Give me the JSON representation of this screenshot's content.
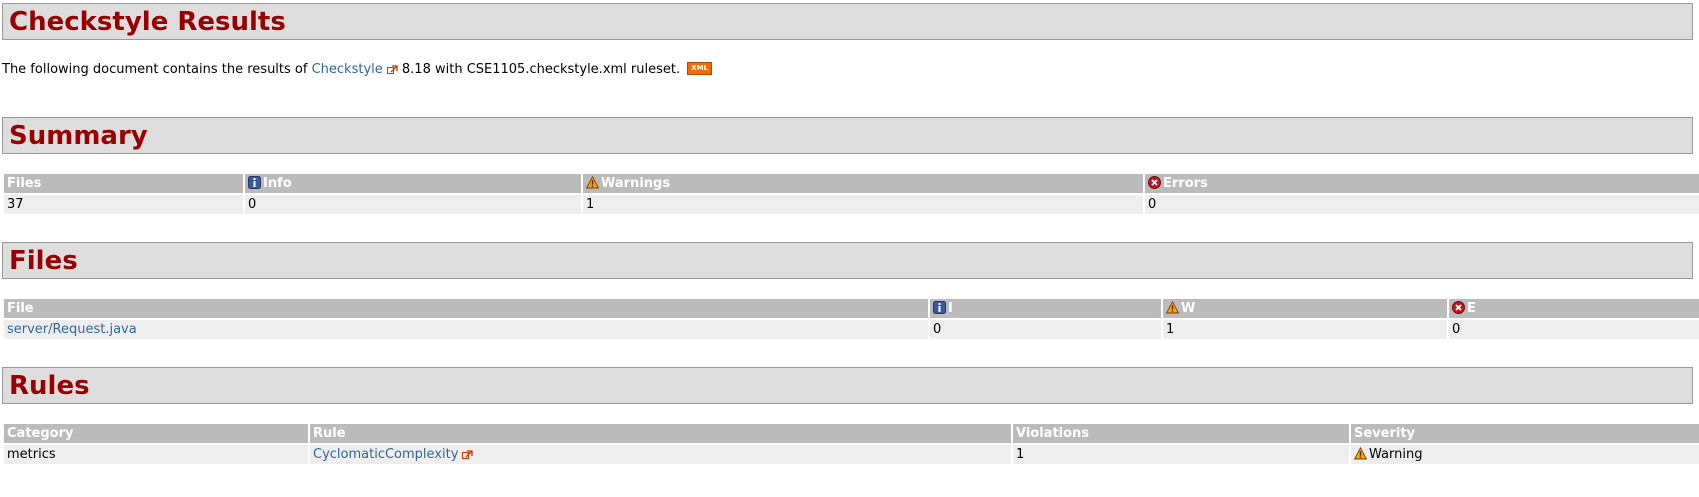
{
  "page_title": "Checkstyle Results",
  "intro": {
    "prefix": "The following document contains the results of ",
    "link": "Checkstyle",
    "suffix": " 8.18 with CSE1105.checkstyle.xml ruleset.",
    "xml_badge": "XML"
  },
  "summary": {
    "title": "Summary",
    "headers": {
      "files": "Files",
      "info": "Info",
      "warnings": "Warnings",
      "errors": "Errors"
    },
    "row": {
      "files": "37",
      "info": "0",
      "warnings": "1",
      "errors": "0"
    }
  },
  "files": {
    "title": "Files",
    "headers": {
      "file": "File",
      "i": "I",
      "w": "W",
      "e": "E"
    },
    "rows": [
      {
        "file": "server/Request.java",
        "i": "0",
        "w": "1",
        "e": "0"
      }
    ]
  },
  "rules": {
    "title": "Rules",
    "headers": {
      "category": "Category",
      "rule": "Rule",
      "violations": "Violations",
      "severity": "Severity"
    },
    "rows": [
      {
        "category": "metrics",
        "rule": "CyclomaticComplexity",
        "violations": "1",
        "severity": "Warning"
      }
    ]
  },
  "colors": {
    "heading": "#990000",
    "link": "#336699",
    "header_bg": "#bbbbbb",
    "cell_bg": "#eeeeee",
    "section_bg": "#dddddd"
  },
  "icons": {
    "info": "info-icon",
    "warning": "warning-icon",
    "error": "error-icon",
    "external": "external-link-icon"
  }
}
